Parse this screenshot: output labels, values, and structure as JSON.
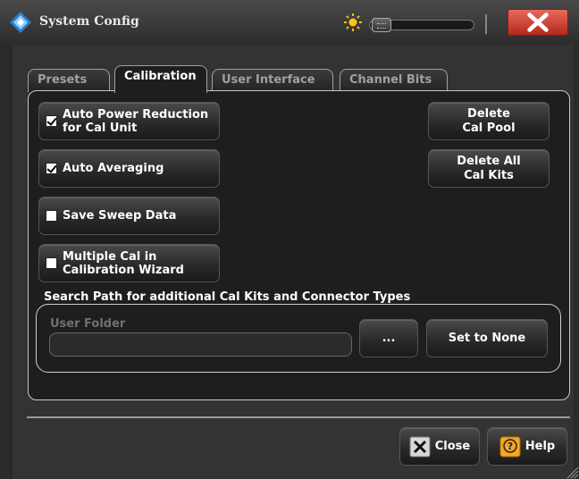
{
  "window": {
    "title": "System Config",
    "logo_icon": "rohde-schwarz-logo",
    "brightness_icon": "sun-icon",
    "close_icon": "close-x-icon"
  },
  "tabs": [
    {
      "label": "Presets",
      "active": false
    },
    {
      "label": "Calibration",
      "active": true
    },
    {
      "label": "User Interface",
      "active": false
    },
    {
      "label": "Channel Bits",
      "active": false
    }
  ],
  "calibration": {
    "checkboxes": [
      {
        "label": "Auto Power Reduction\nfor Cal Unit",
        "checked": true
      },
      {
        "label": "Auto Averaging",
        "checked": true
      },
      {
        "label": "Save Sweep Data",
        "checked": false
      },
      {
        "label": "Multiple Cal in\nCalibration Wizard",
        "checked": false
      }
    ],
    "delete_cal_pool": "Delete\nCal Pool",
    "delete_all_cal_kits": "Delete All\nCal Kits",
    "search_path_label": "Search Path for additional Cal Kits and Connector Types",
    "user_folder_label": "User Folder",
    "user_folder_value": "",
    "browse_label": "...",
    "set_to_none_label": "Set to None"
  },
  "footer": {
    "close_label": "Close",
    "help_label": "Help"
  },
  "colors": {
    "background": "#2a2a2a",
    "panel": "#1e1e1e",
    "title_close": "#c8382a",
    "accent_orange": "#f5a623"
  }
}
